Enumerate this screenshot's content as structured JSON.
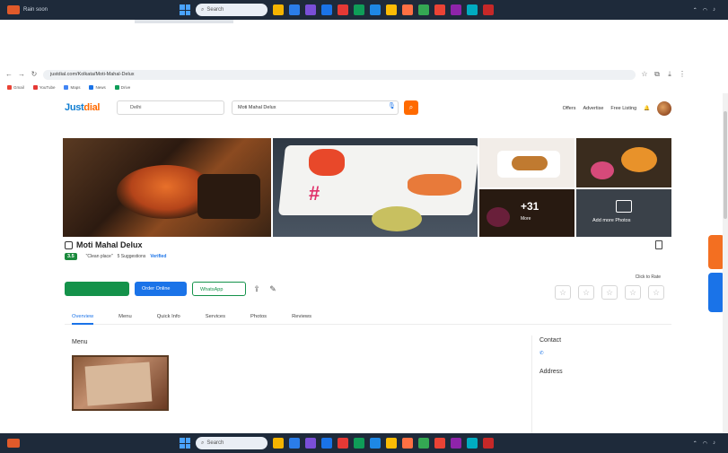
{
  "taskbar_top": {
    "weather_line1": "Rain soon",
    "weather_line2": "",
    "search_label": "Search",
    "clock_time": "",
    "clock_date": ""
  },
  "taskbar_bottom": {
    "weather_line1": "",
    "weather_line2": "",
    "search_label": "Search",
    "clock_time": "",
    "clock_date": ""
  },
  "taskbar_app_colors": [
    "#f4b400",
    "#2b7de9",
    "#7a4fd8",
    "#1a73e8",
    "#e53935",
    "#0f9d58",
    "#1e88e5",
    "#fbbc05",
    "#ff7043",
    "#34a853",
    "#ea4335",
    "#8e24aa",
    "#00acc1",
    "#c62828"
  ],
  "browser": {
    "url": "justdial.com/Kolkata/Moti-Mahal-Delux",
    "bookmarks": [
      "Gmail",
      "YouTube",
      "Maps",
      "News",
      "Drive"
    ]
  },
  "header": {
    "logo_main": "Just",
    "logo_accent": "dial",
    "location_placeholder": "Delhi",
    "query": "Moti Mahal Delux",
    "links": [
      "Offers",
      "Advertise",
      "Free Listing"
    ],
    "new_badge": ""
  },
  "breadcrumb": "",
  "gallery": {
    "more_count": "+31",
    "more_label": "More",
    "add_photos_label": "Add more Photos"
  },
  "listing": {
    "title": "Moti Mahal Delux",
    "rating": "3.5",
    "ratings_count": "",
    "tag": "\"Clean place\"",
    "suggestions": "5 Suggestions",
    "verified": "Verified",
    "locality": "",
    "open_status": "",
    "meta1": "",
    "meta2": "",
    "enquiries": "",
    "call_label": "",
    "order_label": "Order Online",
    "whatsapp_label": "WhatsApp",
    "right_link1": "",
    "right_link2": "",
    "rate_label": "Click to Rate"
  },
  "tabs": [
    "Overview",
    "Menu",
    "Quick Info",
    "Services",
    "Photos",
    "Reviews"
  ],
  "menu_section": {
    "heading": "Menu",
    "bottom_heading": ""
  },
  "contact": {
    "heading": "Contact",
    "phone": "",
    "address_heading": "Address",
    "address": "",
    "directions_label": "",
    "copy_label": ""
  },
  "side_buttons": {
    "orange": "",
    "blue": ""
  }
}
